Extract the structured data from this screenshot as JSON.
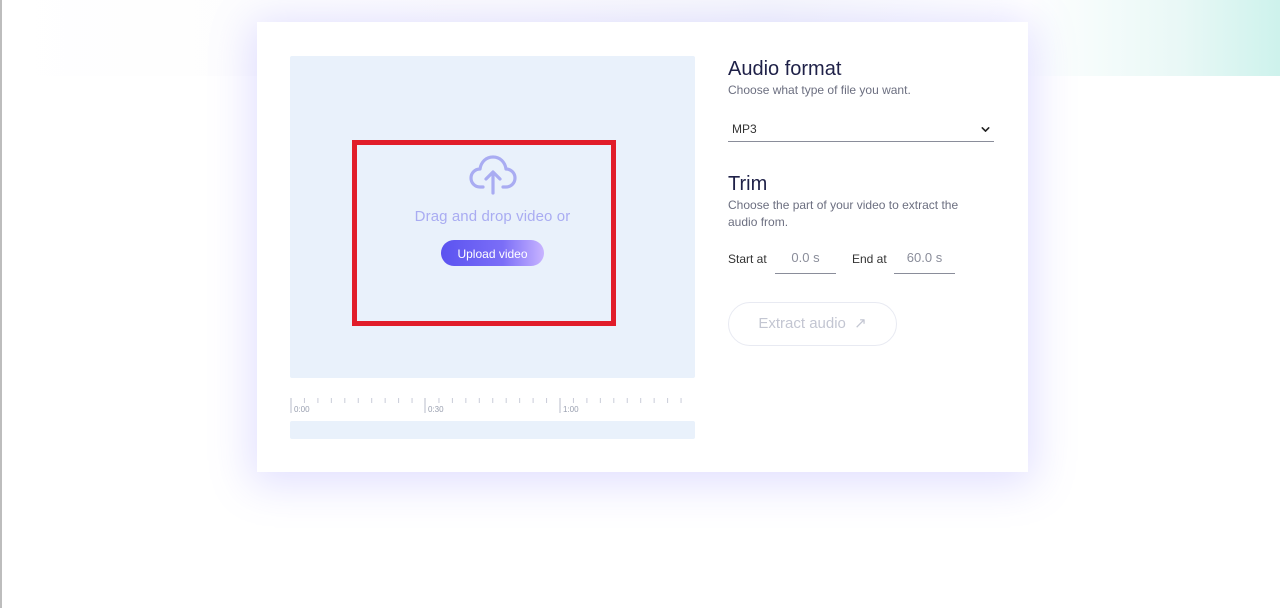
{
  "dropzone": {
    "prompt": "Drag and drop video or",
    "upload_label": "Upload video",
    "icon": "cloud-upload-icon"
  },
  "timeline": {
    "labels": [
      "0:00",
      "0:30",
      "1:00"
    ]
  },
  "audio_format": {
    "title": "Audio format",
    "subtitle": "Choose what type of file you want.",
    "selected": "MP3"
  },
  "trim": {
    "title": "Trim",
    "subtitle": "Choose the part of your video to extract the audio from.",
    "start_label": "Start at",
    "start_value": "0.0 s",
    "end_label": "End at",
    "end_value": "60.0 s"
  },
  "extract": {
    "label": "Extract audio",
    "arrow": "↗"
  },
  "colors": {
    "accent": "#5b53f0",
    "highlight": "#e11d2a",
    "dropzone_bg": "#e9f1fb"
  }
}
